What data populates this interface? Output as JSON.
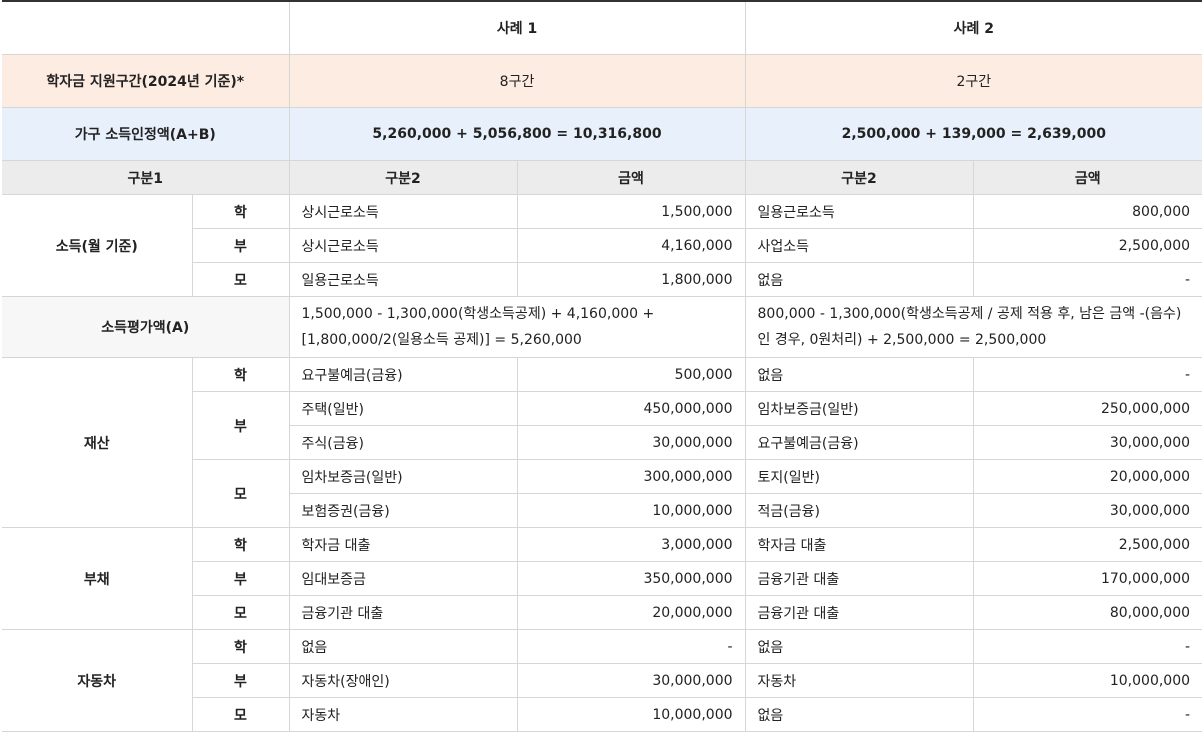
{
  "header": {
    "case1": "사례 1",
    "case2": "사례 2"
  },
  "support_tier": {
    "label": "학자금 지원구간(2024년 기준)*",
    "case1": "8구간",
    "case2": "2구간"
  },
  "household_income": {
    "label": "가구 소득인정액(A+B)",
    "case1": "5,260,000 + 5,056,800 = 10,316,800",
    "case2": "2,500,000 + 139,000 = 2,639,000"
  },
  "columns": {
    "cat1": "구분1",
    "cat2_1": "구분2",
    "amount_1": "금액",
    "cat2_2": "구분2",
    "amount_2": "금액"
  },
  "income": {
    "label": "소득(월 기준)",
    "rows": [
      {
        "who": "학",
        "c1_type": "상시근로소득",
        "c1_amt": "1,500,000",
        "c2_type": "일용근로소득",
        "c2_amt": "800,000"
      },
      {
        "who": "부",
        "c1_type": "상시근로소득",
        "c1_amt": "4,160,000",
        "c2_type": "사업소득",
        "c2_amt": "2,500,000"
      },
      {
        "who": "모",
        "c1_type": "일용근로소득",
        "c1_amt": "1,800,000",
        "c2_type": "없음",
        "c2_amt": "-"
      }
    ]
  },
  "income_eval": {
    "label": "소득평가액(A)",
    "case1": "1,500,000 - 1,300,000(학생소득공제) + 4,160,000 + [1,800,000/2(일용소득 공제)] = 5,260,000",
    "case2": "800,000 - 1,300,000(학생소득공제 / 공제 적용 후, 남은 금액 -(음수)인 경우, 0원처리) + 2,500,000 = 2,500,000"
  },
  "assets": {
    "label": "재산",
    "student": {
      "who": "학",
      "c1_type": "요구불예금(금융)",
      "c1_amt": "500,000",
      "c2_type": "없음",
      "c2_amt": "-"
    },
    "father": {
      "who": "부",
      "rows": [
        {
          "c1_type": "주택(일반)",
          "c1_amt": "450,000,000",
          "c2_type": "임차보증금(일반)",
          "c2_amt": "250,000,000"
        },
        {
          "c1_type": "주식(금융)",
          "c1_amt": "30,000,000",
          "c2_type": "요구불예금(금융)",
          "c2_amt": "30,000,000"
        }
      ]
    },
    "mother": {
      "who": "모",
      "rows": [
        {
          "c1_type": "임차보증금(일반)",
          "c1_amt": "300,000,000",
          "c2_type": "토지(일반)",
          "c2_amt": "20,000,000"
        },
        {
          "c1_type": "보험증권(금융)",
          "c1_amt": "10,000,000",
          "c2_type": "적금(금융)",
          "c2_amt": "30,000,000"
        }
      ]
    }
  },
  "debt": {
    "label": "부채",
    "rows": [
      {
        "who": "학",
        "c1_type": "학자금 대출",
        "c1_amt": "3,000,000",
        "c2_type": "학자금 대출",
        "c2_amt": "2,500,000"
      },
      {
        "who": "부",
        "c1_type": "임대보증금",
        "c1_amt": "350,000,000",
        "c2_type": "금융기관 대출",
        "c2_amt": "170,000,000"
      },
      {
        "who": "모",
        "c1_type": "금융기관 대출",
        "c1_amt": "20,000,000",
        "c2_type": "금융기관 대출",
        "c2_amt": "80,000,000"
      }
    ]
  },
  "car": {
    "label": "자동차",
    "rows": [
      {
        "who": "학",
        "c1_type": "없음",
        "c1_amt": "-",
        "c2_type": "없음",
        "c2_amt": "-"
      },
      {
        "who": "부",
        "c1_type": "자동차(장애인)",
        "c1_amt": "30,000,000",
        "c2_type": "자동차",
        "c2_amt": "10,000,000"
      },
      {
        "who": "모",
        "c1_type": "자동차",
        "c1_amt": "10,000,000",
        "c2_type": "없음",
        "c2_amt": "-"
      }
    ]
  }
}
